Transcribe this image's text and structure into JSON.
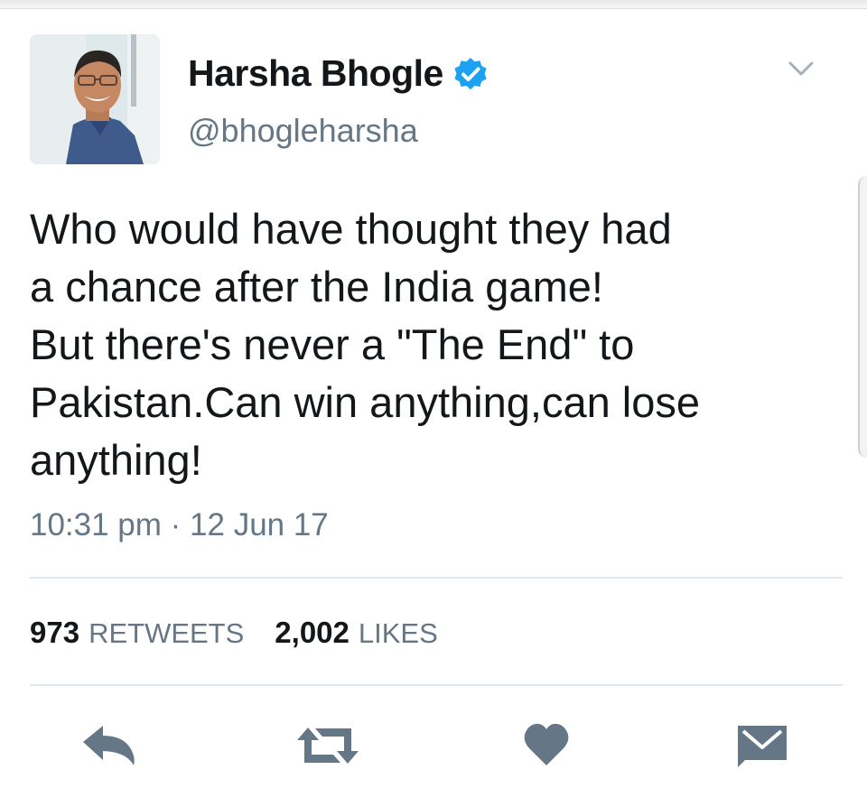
{
  "author": {
    "display_name": "Harsha Bhogle",
    "handle": "@bhogleharsha",
    "verified": true
  },
  "tweet": {
    "text": "Who would have thought they had\na chance after the India game!\nBut there's never a \"The End\" to\nPakistan.Can win anything,can lose\nanything!",
    "timestamp": "10:31 pm · 12 Jun 17"
  },
  "stats": {
    "retweets_count": "973",
    "retweets_label": "RETWEETS",
    "likes_count": "2,002",
    "likes_label": "LIKES"
  },
  "icons": {
    "verified": "verified-badge-icon",
    "menu": "chevron-down-icon",
    "reply": "reply-icon",
    "retweet": "retweet-icon",
    "like": "heart-icon",
    "message": "envelope-icon"
  },
  "colors": {
    "text_primary": "#14171a",
    "text_secondary": "#657786",
    "verified_blue": "#1da1f2",
    "action_icon": "#657786",
    "divider": "#e1e8ed"
  }
}
